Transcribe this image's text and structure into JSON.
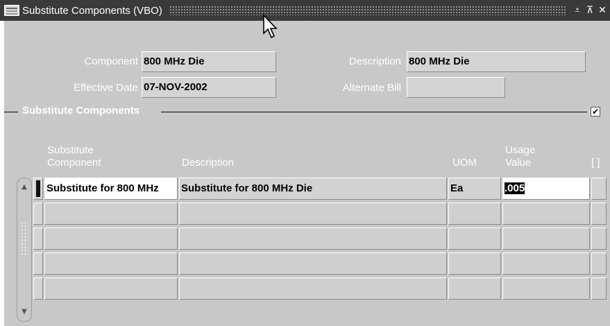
{
  "window": {
    "title": "Substitute Components (VBO)",
    "controls": [
      "minimize",
      "maximize",
      "close"
    ]
  },
  "header": {
    "component_label": "Component",
    "component_value": "800 MHz Die",
    "description_label": "Description",
    "description_value": "800 MHz Die",
    "effective_date_label": "Effective Date",
    "effective_date_value": "07-NOV-2002",
    "alternate_bill_label": "Alternate Bill",
    "alternate_bill_value": ""
  },
  "region": {
    "title": "Substitute Components",
    "checkbox_checked": true,
    "checkbox_glyph": "✔"
  },
  "table": {
    "columns": {
      "substitute_line1": "Substitute",
      "substitute_line2": "Component",
      "description": "Description",
      "uom": "UOM",
      "usage_line1": "Usage",
      "usage_line2": "Value",
      "dff": "[ ]"
    },
    "rows": [
      {
        "component": "Substitute for 800 MHz",
        "description": "Substitute for 800 MHz Die",
        "uom": "Ea",
        "usage": ".005",
        "current": true
      },
      {
        "component": "",
        "description": "",
        "uom": "",
        "usage": "",
        "current": false
      },
      {
        "component": "",
        "description": "",
        "uom": "",
        "usage": "",
        "current": false
      },
      {
        "component": "",
        "description": "",
        "uom": "",
        "usage": "",
        "current": false
      },
      {
        "component": "",
        "description": "",
        "uom": "",
        "usage": "",
        "current": false
      }
    ]
  },
  "icons": {
    "scroll_up": "▲",
    "scroll_down": "▼",
    "minimize": "⩡",
    "maximize": "⊼",
    "close": "✕"
  },
  "colors": {
    "title_bar": "#3a3a3a",
    "window_bg": "#c8c8c8",
    "field_bg": "#d4d4d4",
    "active_field_bg": "#ffffff"
  }
}
